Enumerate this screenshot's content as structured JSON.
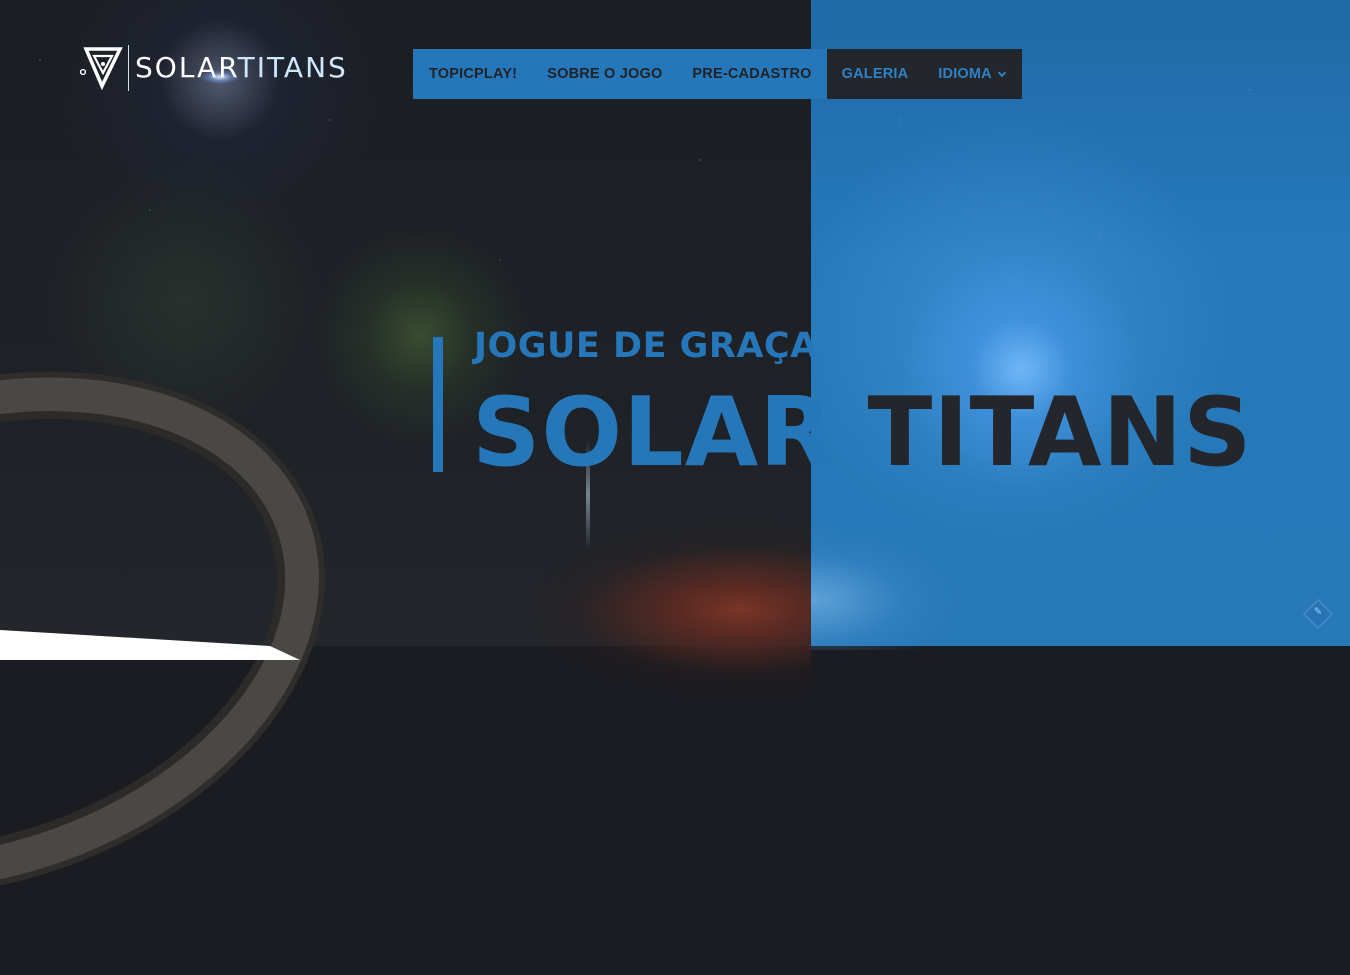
{
  "brand": {
    "word1": "SOLAR",
    "word2": "TITANS",
    "logo_icon": "solartitans-triangle-logo"
  },
  "nav": {
    "items": [
      {
        "label": "TOPICPLAY!"
      },
      {
        "label": "SOBRE O JOGO"
      },
      {
        "label": "PRE-CADASTRO"
      },
      {
        "label": "GALERIA"
      },
      {
        "label": "IDIOMA"
      }
    ],
    "dropdown_icon": "chevron-down-icon"
  },
  "hero": {
    "kicker": "JOGUE DE GRAÇA",
    "title_word1": "SOLAR",
    "title_word2": "TITANS"
  },
  "colors": {
    "accent_blue": "#2677ba",
    "dark": "#23262a"
  },
  "corner_widget": {
    "icon": "feedback-badge-icon"
  }
}
